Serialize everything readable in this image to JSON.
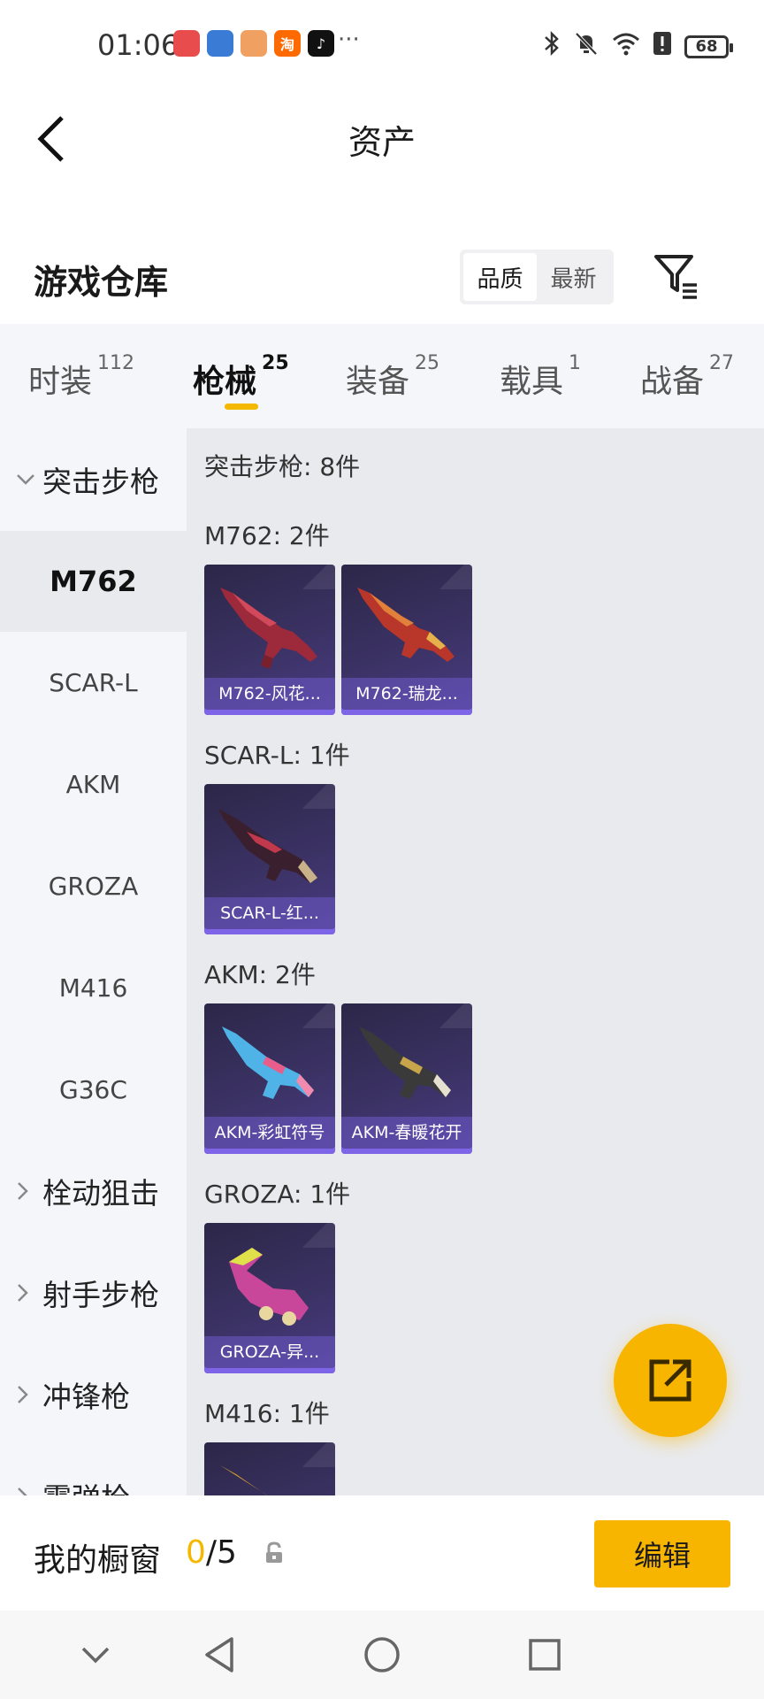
{
  "status_bar": {
    "time": "01:06",
    "apps": [
      {
        "icon": "huawei-app-icon",
        "label": "",
        "color": "#e84c4c"
      },
      {
        "icon": "game-app-icon",
        "label": "",
        "color": "#3a7bd5"
      },
      {
        "icon": "anime-app-icon",
        "label": "",
        "color": "#f0a060"
      },
      {
        "icon": "taobao-app-icon",
        "label": "淘",
        "color": "#ff6a00"
      },
      {
        "icon": "tiktok-app-icon",
        "label": "♪",
        "color": "#111111"
      }
    ],
    "more": "···",
    "battery": "68"
  },
  "header": {
    "title": "资产"
  },
  "section": {
    "title": "游戏仓库",
    "sort_options": [
      "品质",
      "最新"
    ]
  },
  "tabs": [
    {
      "label": "时装",
      "count": "112"
    },
    {
      "label": "枪械",
      "count": "25"
    },
    {
      "label": "装备",
      "count": "25"
    },
    {
      "label": "载具",
      "count": "1"
    },
    {
      "label": "战备",
      "count": "27"
    }
  ],
  "sidebar": {
    "groups": [
      {
        "label": "突击步枪",
        "expanded": true
      },
      {
        "label": "栓动狙击",
        "expanded": false
      },
      {
        "label": "射手步枪",
        "expanded": false
      },
      {
        "label": "冲锋枪",
        "expanded": false
      },
      {
        "label": "霰弹枪",
        "expanded": false
      }
    ],
    "items": [
      "M762",
      "SCAR-L",
      "AKM",
      "GROZA",
      "M416",
      "G36C"
    ],
    "selected": "M762"
  },
  "content": {
    "total_label": "突击步枪: 8件",
    "sections": [
      {
        "label": "M762: 2件",
        "items": [
          "M762-风花...",
          "M762-瑞龙..."
        ]
      },
      {
        "label": "SCAR-L: 1件",
        "items": [
          "SCAR-L-红..."
        ]
      },
      {
        "label": "AKM: 2件",
        "items": [
          "AKM-彩虹符号",
          "AKM-春暖花开"
        ]
      },
      {
        "label": "GROZA: 1件",
        "items": [
          "GROZA-异..."
        ]
      },
      {
        "label": "M416: 1件",
        "items": [
          ""
        ]
      }
    ]
  },
  "bottom": {
    "showcase_label": "我的橱窗",
    "showcase_current": "0",
    "showcase_total": "/5",
    "edit_label": "编辑"
  },
  "colors": {
    "accent": "#f7b500",
    "card_bg": "#3b3264"
  }
}
